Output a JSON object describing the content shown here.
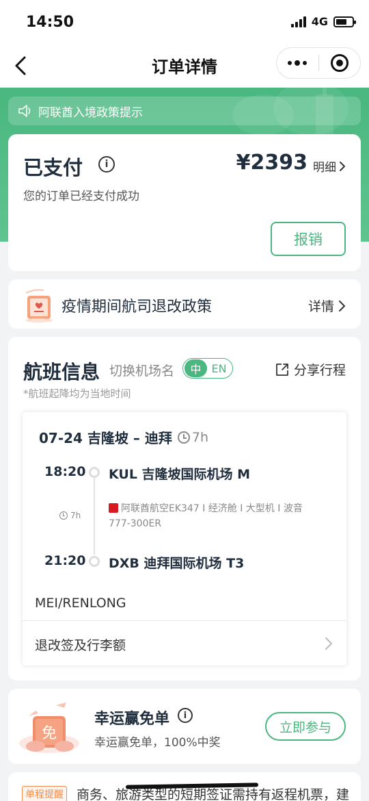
{
  "status_bar": {
    "time": "14:50",
    "network": "4G"
  },
  "nav": {
    "title": "订单详情"
  },
  "notice": {
    "text": "阿联酋入境政策提示"
  },
  "order_status": {
    "title": "已支付",
    "price": "¥2393",
    "detail_label": "明细",
    "subtitle": "您的订单已经支付成功",
    "reimburse_label": "报销"
  },
  "policy": {
    "text": "疫情期间航司退改政策",
    "detail_label": "详情"
  },
  "flight": {
    "title": "航班信息",
    "switch_label": "切换机场名",
    "lang_zh": "中",
    "lang_en": "EN",
    "share_label": "分享行程",
    "note": "*航班起降均为当地时间",
    "segment": {
      "date_route": "07-24 吉隆坡 – 迪拜",
      "duration": "7h",
      "depart_time": "18:20",
      "depart_airport": "KUL 吉隆坡国际机场 M",
      "mid_duration": "7h",
      "airline_info": "阿联酋航空EK347 I 经济舱 I 大型机 I 波音777-300ER",
      "arrive_time": "21:20",
      "arrive_airport": "DXB 迪拜国际机场 T3",
      "passenger": "MEI/RENLONG",
      "baggage_label": "退改签及行李额"
    }
  },
  "lucky": {
    "title": "幸运赢免单",
    "subtitle": "幸运赢免单，100%中奖",
    "join_label": "立即参与",
    "icon_text": "免"
  },
  "reminder": {
    "tag": "单程提醒",
    "text": "商务、旅游类型的短期签证需持有返程机票，建"
  },
  "colors": {
    "brand_green": "#49b77f",
    "warning_orange": "#f28b4b"
  }
}
